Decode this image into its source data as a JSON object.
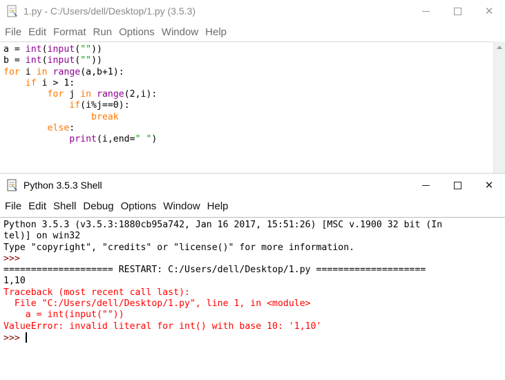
{
  "editor": {
    "title": "1.py - C:/Users/dell/Desktop/1.py (3.5.3)",
    "menu": [
      "File",
      "Edit",
      "Format",
      "Run",
      "Options",
      "Window",
      "Help"
    ],
    "code_lines": [
      [
        {
          "t": "a = ",
          "c": "pl"
        },
        {
          "t": "int",
          "c": "bi"
        },
        {
          "t": "(",
          "c": "pl"
        },
        {
          "t": "input",
          "c": "bi"
        },
        {
          "t": "(",
          "c": "pl"
        },
        {
          "t": "\"\"",
          "c": "str"
        },
        {
          "t": "))",
          "c": "pl"
        }
      ],
      [
        {
          "t": "b = ",
          "c": "pl"
        },
        {
          "t": "int",
          "c": "bi"
        },
        {
          "t": "(",
          "c": "pl"
        },
        {
          "t": "input",
          "c": "bi"
        },
        {
          "t": "(",
          "c": "pl"
        },
        {
          "t": "\"\"",
          "c": "str"
        },
        {
          "t": "))",
          "c": "pl"
        }
      ],
      [
        {
          "t": "for",
          "c": "kw"
        },
        {
          "t": " i ",
          "c": "pl"
        },
        {
          "t": "in",
          "c": "kw"
        },
        {
          "t": " ",
          "c": "pl"
        },
        {
          "t": "range",
          "c": "bi"
        },
        {
          "t": "(a,b+1):",
          "c": "pl"
        }
      ],
      [
        {
          "t": "    ",
          "c": "pl"
        },
        {
          "t": "if",
          "c": "kw"
        },
        {
          "t": " i > 1:",
          "c": "pl"
        }
      ],
      [
        {
          "t": "        ",
          "c": "pl"
        },
        {
          "t": "for",
          "c": "kw"
        },
        {
          "t": " j ",
          "c": "pl"
        },
        {
          "t": "in",
          "c": "kw"
        },
        {
          "t": " ",
          "c": "pl"
        },
        {
          "t": "range",
          "c": "bi"
        },
        {
          "t": "(2,i):",
          "c": "pl"
        }
      ],
      [
        {
          "t": "            ",
          "c": "pl"
        },
        {
          "t": "if",
          "c": "kw"
        },
        {
          "t": "(i%j==0):",
          "c": "pl"
        }
      ],
      [
        {
          "t": "                ",
          "c": "pl"
        },
        {
          "t": "break",
          "c": "kw"
        }
      ],
      [
        {
          "t": "        ",
          "c": "pl"
        },
        {
          "t": "else",
          "c": "kw"
        },
        {
          "t": ":",
          "c": "pl"
        }
      ],
      [
        {
          "t": "            ",
          "c": "pl"
        },
        {
          "t": "print",
          "c": "bi"
        },
        {
          "t": "(i,end=",
          "c": "pl"
        },
        {
          "t": "\" \"",
          "c": "str"
        },
        {
          "t": ")",
          "c": "pl"
        }
      ]
    ]
  },
  "shell": {
    "title": "Python 3.5.3 Shell",
    "menu": [
      "File",
      "Edit",
      "Shell",
      "Debug",
      "Options",
      "Window",
      "Help"
    ],
    "lines": [
      [
        {
          "t": "Python 3.5.3 (v3.5.3:1880cb95a742, Jan 16 2017, 15:51:26) [MSC v.1900 32 bit (In",
          "c": "pl"
        }
      ],
      [
        {
          "t": "tel)] on win32",
          "c": "pl"
        }
      ],
      [
        {
          "t": "Type \"copyright\", \"credits\" or \"license()\" for more information.",
          "c": "pl"
        }
      ],
      [
        {
          "t": ">>> ",
          "c": "prompt"
        }
      ],
      [
        {
          "t": "==================== RESTART: C:/Users/dell/Desktop/1.py ====================",
          "c": "pl"
        }
      ],
      [
        {
          "t": "1,10",
          "c": "pl"
        }
      ],
      [
        {
          "t": "Traceback (most recent call last):",
          "c": "err"
        }
      ],
      [
        {
          "t": "  File \"C:/Users/dell/Desktop/1.py\", line 1, in <module>",
          "c": "err"
        }
      ],
      [
        {
          "t": "    a = int(input(\"\"))",
          "c": "err"
        }
      ],
      [
        {
          "t": "ValueError: invalid literal for int() with base 10: '1,10'",
          "c": "err"
        }
      ],
      [
        {
          "t": ">>> ",
          "c": "prompt"
        }
      ]
    ]
  },
  "colors": {
    "keyword": "#ff7700",
    "builtin": "#900090",
    "string": "#00aa00",
    "error": "#ff0000",
    "prompt": "#800000"
  },
  "icons": {
    "editor": "idle-file-icon",
    "shell": "python-shell-icon",
    "minimize": "minimize-icon",
    "maximize": "maximize-icon",
    "close": "close-icon"
  }
}
